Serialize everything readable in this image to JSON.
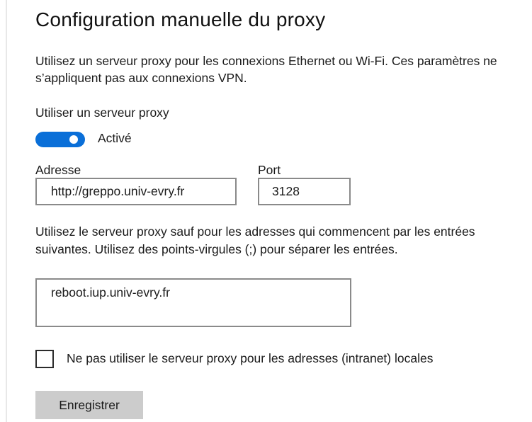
{
  "page": {
    "title": "Configuration manuelle du proxy",
    "description": "Utilisez un serveur proxy pour les connexions Ethernet ou Wi-Fi. Ces paramètres ne s’appliquent pas aux connexions VPN."
  },
  "proxy_toggle": {
    "label": "Utiliser un serveur proxy",
    "state_label": "Activé",
    "enabled": true,
    "accent_color": "#0a6fd8"
  },
  "address": {
    "label": "Adresse",
    "value": "http://greppo.univ-evry.fr"
  },
  "port": {
    "label": "Port",
    "value": "3128"
  },
  "exceptions": {
    "description": "Utilisez le serveur proxy sauf pour les adresses qui commencent par les entrées suivantes. Utilisez des points-virgules (;) pour séparer les entrées.",
    "value": "reboot.iup.univ-evry.fr"
  },
  "local_bypass": {
    "label": "Ne pas utiliser le serveur proxy pour les adresses (intranet) locales",
    "checked": false
  },
  "save_button": {
    "label": "Enregistrer"
  }
}
